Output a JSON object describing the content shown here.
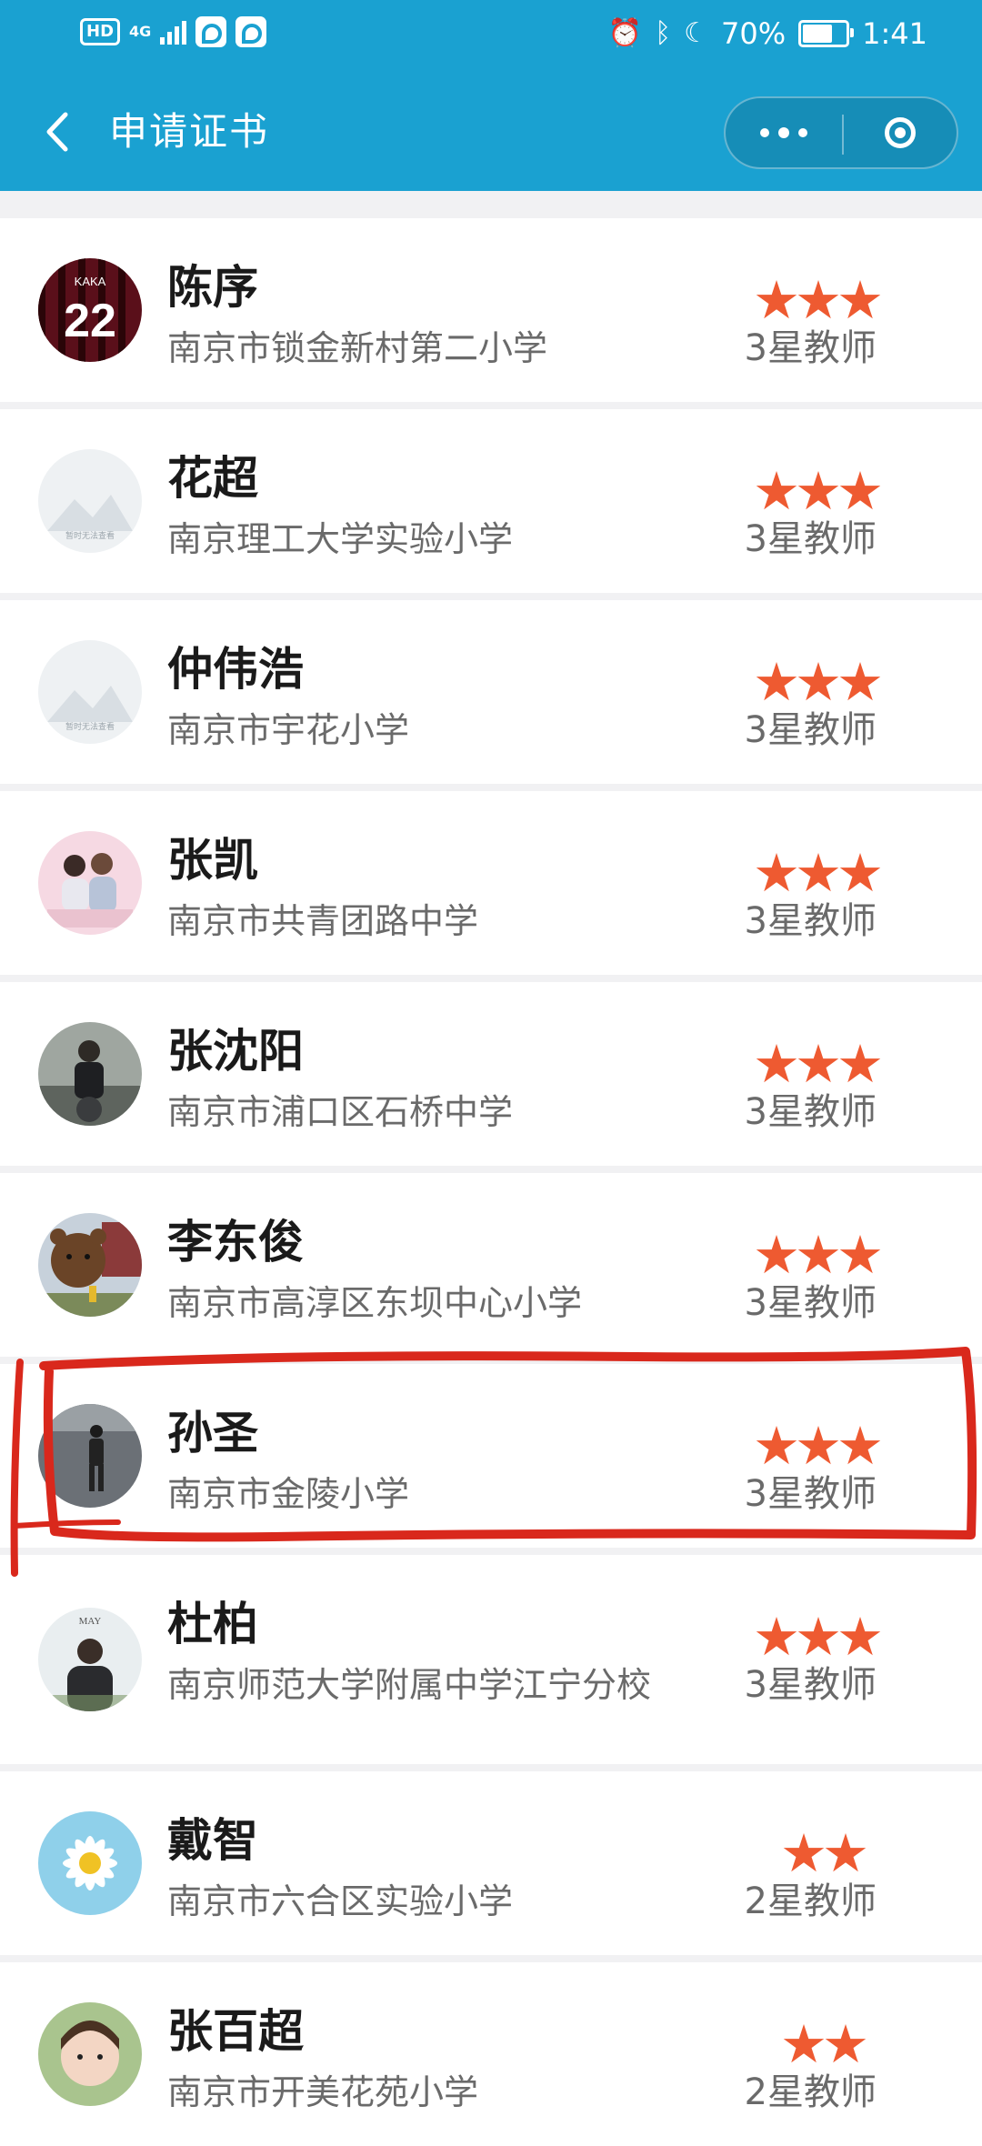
{
  "status_bar": {
    "hd": "HD",
    "network": "4G",
    "battery_level": "70%",
    "time": "1:41"
  },
  "navbar": {
    "title": "申请证书"
  },
  "teachers": [
    {
      "name": "陈序",
      "school": "南京市锁金新村第二小学",
      "stars": "★★★",
      "rank": "3星教师",
      "avatar": "jersey-22"
    },
    {
      "name": "花超",
      "school": "南京理工大学实验小学",
      "stars": "★★★",
      "rank": "3星教师",
      "avatar": "placeholder"
    },
    {
      "name": "仲伟浩",
      "school": "南京市宇花小学",
      "stars": "★★★",
      "rank": "3星教师",
      "avatar": "placeholder"
    },
    {
      "name": "张凯",
      "school": "南京市共青团路中学",
      "stars": "★★★",
      "rank": "3星教师",
      "avatar": "couple-photo"
    },
    {
      "name": "张沈阳",
      "school": "南京市浦口区石桥中学",
      "stars": "★★★",
      "rank": "3星教师",
      "avatar": "person-photo"
    },
    {
      "name": "李东俊",
      "school": "南京市高淳区东坝中心小学",
      "stars": "★★★",
      "rank": "3星教师",
      "avatar": "bear-photo"
    },
    {
      "name": "孙圣",
      "school": "南京市金陵小学",
      "stars": "★★★",
      "rank": "3星教师",
      "avatar": "field-photo"
    },
    {
      "name": "杜柏",
      "school": "南京师范大学附属中学江宁分校",
      "stars": "★★★",
      "rank": "3星教师",
      "avatar": "portrait-photo"
    },
    {
      "name": "戴智",
      "school": "南京市六合区实验小学",
      "stars": "★★",
      "rank": "2星教师",
      "avatar": "daisy-photo"
    },
    {
      "name": "张百超",
      "school": "南京市开美花苑小学",
      "stars": "★★",
      "rank": "2星教师",
      "avatar": "child-photo"
    }
  ],
  "colors": {
    "header": "#1aa1d1",
    "star": "#ee5a31",
    "highlight": "#d9281c"
  }
}
